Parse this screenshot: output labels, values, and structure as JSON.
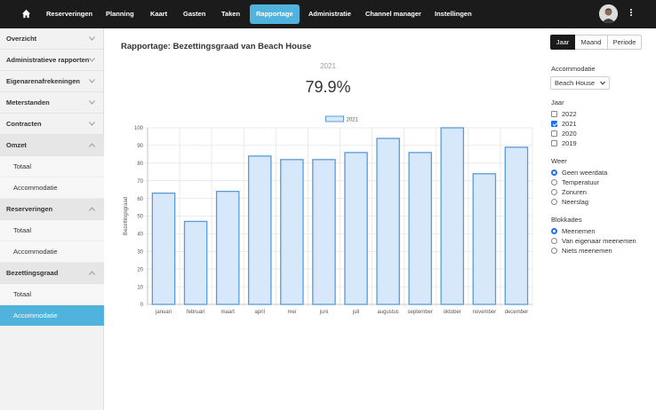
{
  "nav": {
    "items": [
      "Reserveringen",
      "Planning",
      "Kaart",
      "Gasten",
      "Taken",
      "Rapportage",
      "Administratie",
      "Channel manager",
      "Instellingen"
    ],
    "active": "Rapportage"
  },
  "sidebar": {
    "items": [
      {
        "label": "Overzicht",
        "type": "header"
      },
      {
        "label": "Administratieve rapporten",
        "type": "header"
      },
      {
        "label": "Eigenarenafrekeningen",
        "type": "header"
      },
      {
        "label": "Meterstanden",
        "type": "header"
      },
      {
        "label": "Contracten",
        "type": "header"
      },
      {
        "label": "Omzet",
        "type": "header",
        "open": true
      },
      {
        "label": "Totaal",
        "type": "sub"
      },
      {
        "label": "Accommodatie",
        "type": "sub"
      },
      {
        "label": "Reserveringen",
        "type": "header",
        "open": true
      },
      {
        "label": "Totaal",
        "type": "sub"
      },
      {
        "label": "Accommodatie",
        "type": "sub"
      },
      {
        "label": "Bezettingsgraad",
        "type": "header",
        "open": true
      },
      {
        "label": "Totaal",
        "type": "sub"
      },
      {
        "label": "Accommodatie",
        "type": "sub",
        "active": true
      }
    ]
  },
  "main": {
    "title": "Rapportage: Bezettingsgraad van Beach House",
    "year": "2021",
    "value": "79.9%"
  },
  "period_tabs": {
    "jaar": "Jaar",
    "maand": "Maand",
    "periode": "Periode",
    "active": "Jaar"
  },
  "filters": {
    "accommodatie_label": "Accommodatie",
    "accommodatie_value": "Beach House",
    "jaar_label": "Jaar",
    "jaar_options": [
      "2022",
      "2021",
      "2020",
      "2019"
    ],
    "jaar_checked": [
      "2021"
    ],
    "weer_label": "Weer",
    "weer_options": [
      "Geen weerdata",
      "Temperatuur",
      "Zonuren",
      "Neerslag"
    ],
    "weer_selected": "Geen weerdata",
    "blokkades_label": "Blokkades",
    "blokkades_options": [
      "Meenemen",
      "Van eigenaar meenemen",
      "Niets meenemen"
    ],
    "blokkades_selected": "Meenemen"
  },
  "chart_data": {
    "type": "bar",
    "categories": [
      "januari",
      "februari",
      "maart",
      "april",
      "mei",
      "juni",
      "juli",
      "augustus",
      "september",
      "oktober",
      "november",
      "december"
    ],
    "series": [
      {
        "name": "2021",
        "values": [
          63,
          47,
          64,
          84,
          82,
          82,
          86,
          94,
          86,
          100,
          74,
          89
        ]
      }
    ],
    "ylabel": "Bezettingsgraad",
    "ylim": [
      0,
      100
    ],
    "yticks": [
      0,
      10,
      20,
      30,
      40,
      50,
      60,
      70,
      80,
      90,
      100
    ],
    "grid": true,
    "legend": "top",
    "colors": {
      "bar_fill": "#d6e8f9",
      "bar_stroke": "#5a9bd8"
    }
  },
  "colors": {
    "accent": "#4fb3dd",
    "nav_bg": "#1b1b1b"
  }
}
